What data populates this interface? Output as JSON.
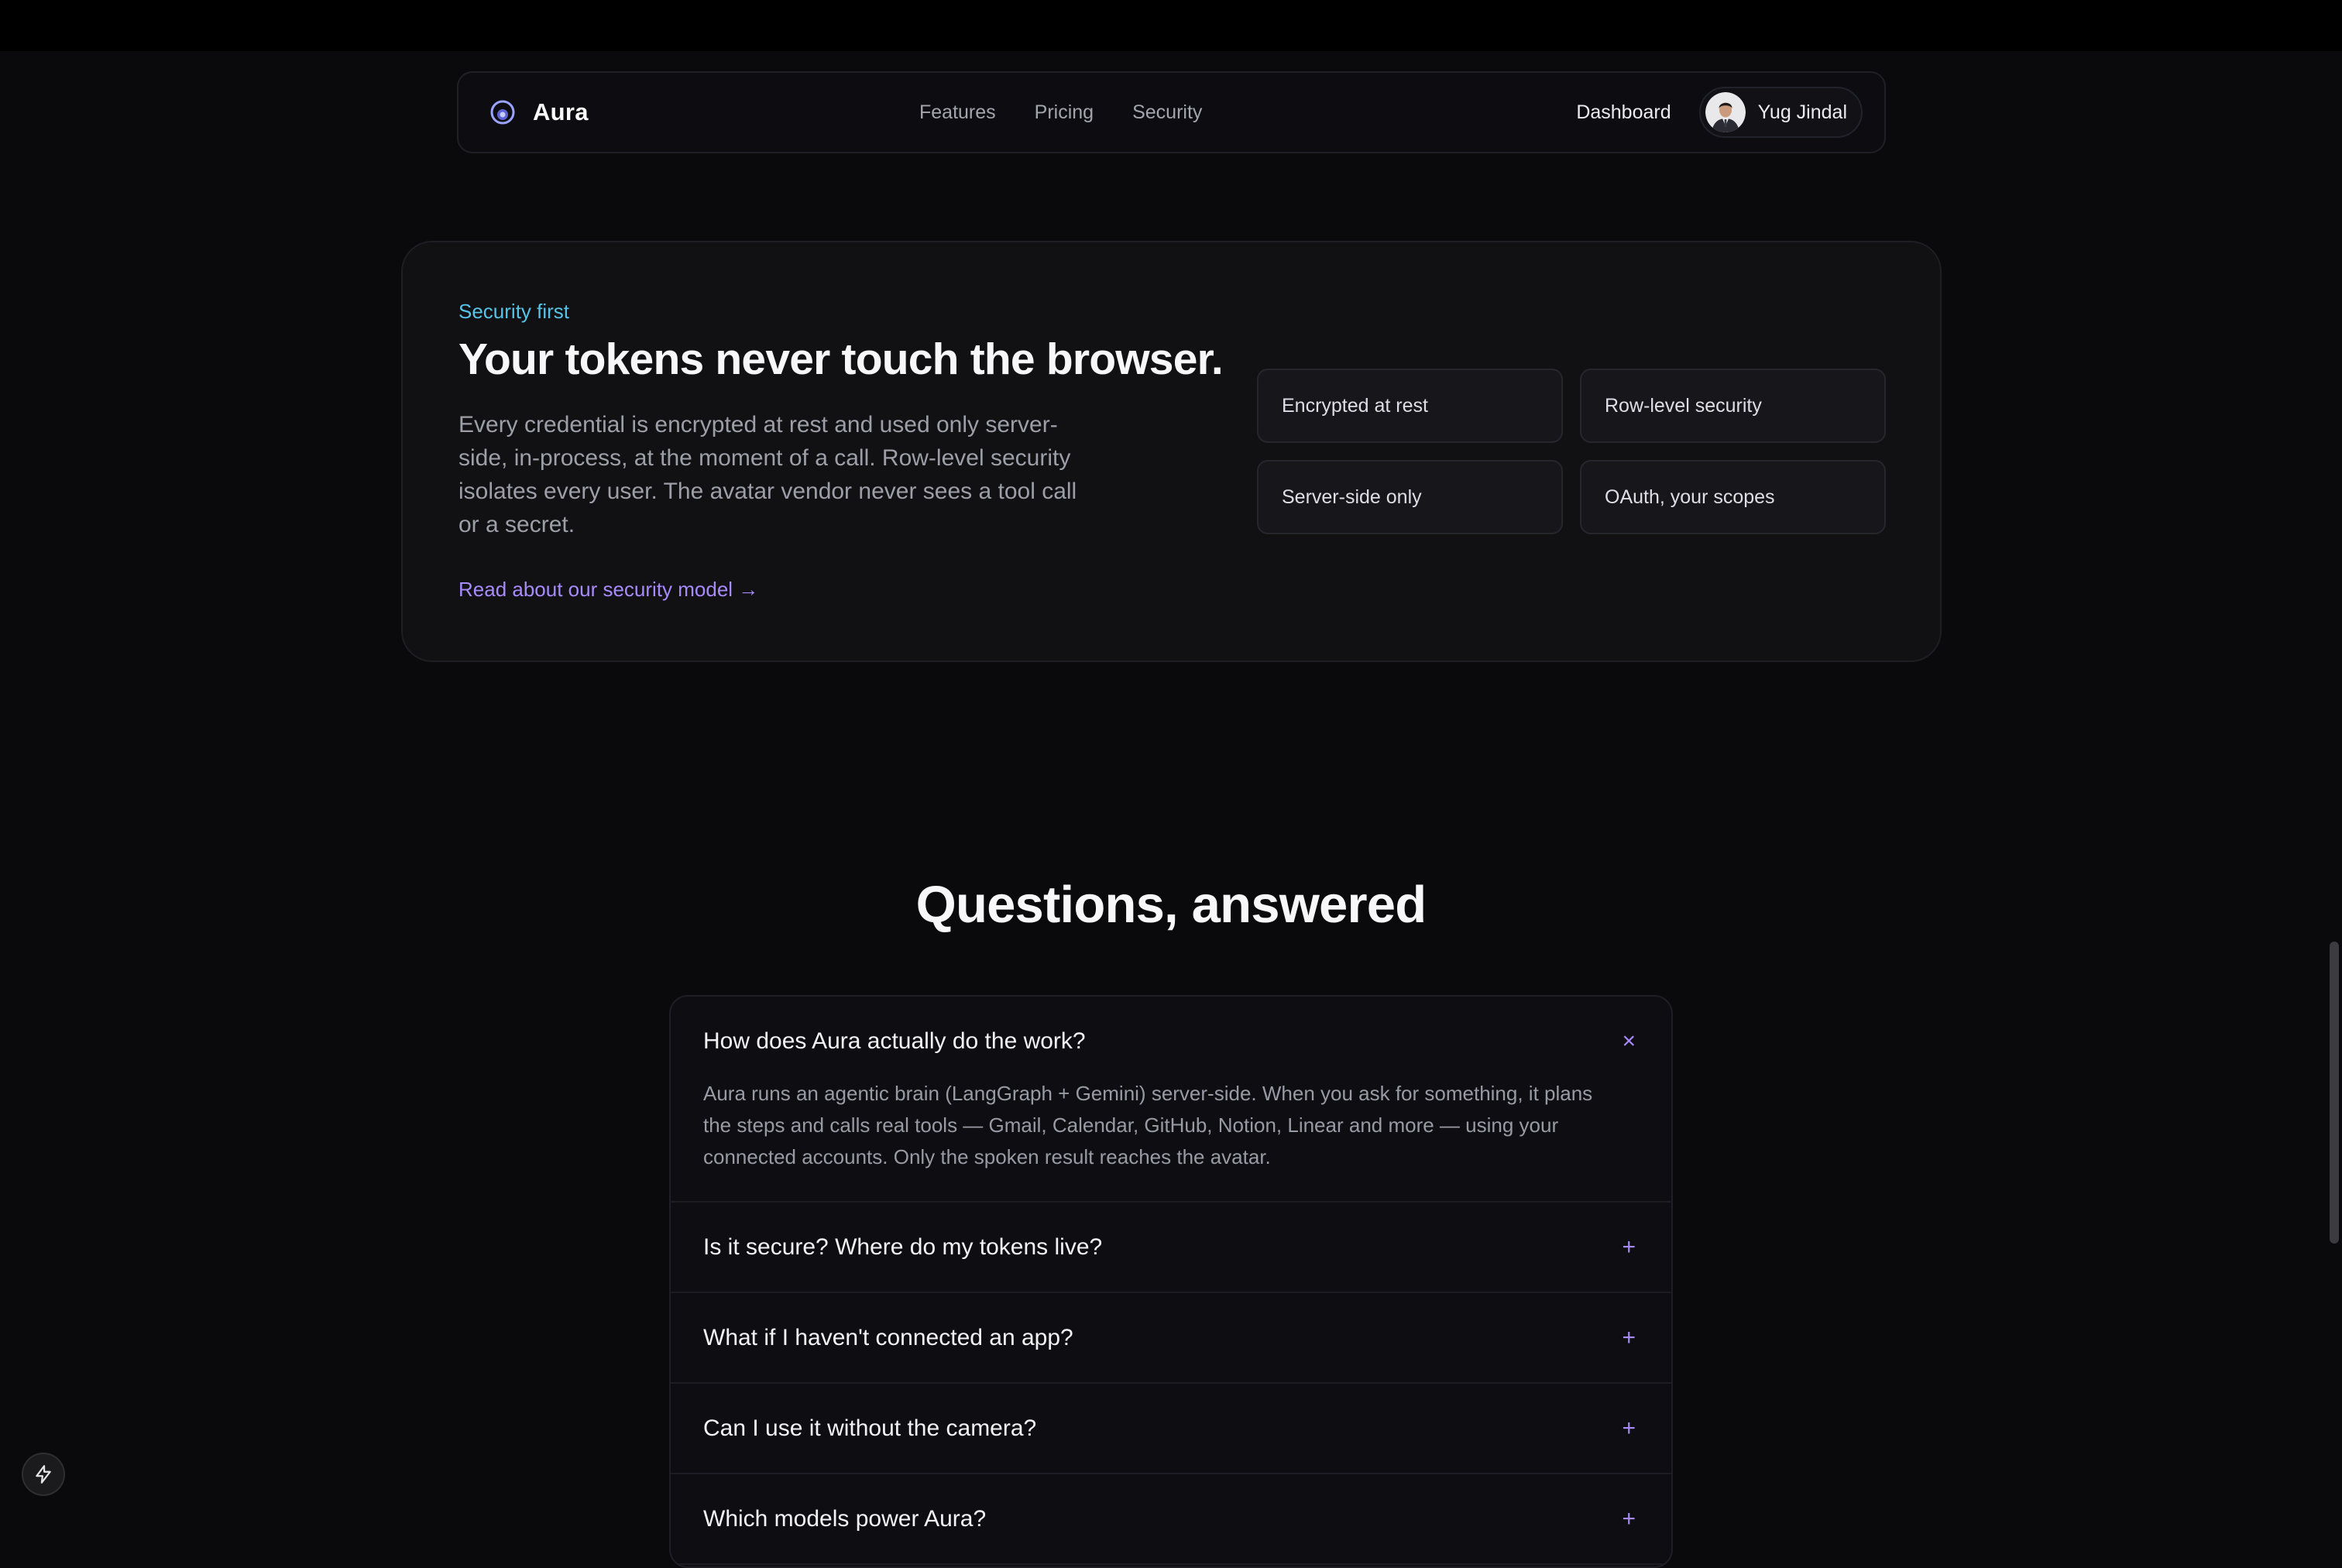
{
  "nav": {
    "brand": "Aura",
    "links": [
      "Features",
      "Pricing",
      "Security"
    ],
    "dashboard": "Dashboard",
    "user_name": "Yug Jindal"
  },
  "security": {
    "eyebrow": "Security first",
    "title": "Your tokens never touch the browser.",
    "body": "Every credential is encrypted at rest and used only server-side, in-process, at the moment of a call. Row-level security isolates every user. The avatar vendor never sees a tool call or a secret.",
    "link": "Read about our security model →",
    "features": [
      "Encrypted at rest",
      "Row-level security",
      "Server-side only",
      "OAuth, your scopes"
    ]
  },
  "faq": {
    "title": "Questions, answered",
    "items": [
      {
        "question": "How does Aura actually do the work?",
        "answer": "Aura runs an agentic brain (LangGraph + Gemini) server-side. When you ask for something, it plans the steps and calls real tools — Gmail, Calendar, GitHub, Notion, Linear and more — using your connected accounts. Only the spoken result reaches the avatar.",
        "toggle": "×"
      },
      {
        "question": "Is it secure? Where do my tokens live?",
        "toggle": "+"
      },
      {
        "question": "What if I haven't connected an app?",
        "toggle": "+"
      },
      {
        "question": "Can I use it without the camera?",
        "toggle": "+"
      },
      {
        "question": "Which models power Aura?",
        "toggle": "+"
      }
    ]
  },
  "colors": {
    "accent_cyan": "#58c3e6",
    "accent_purple": "#a78bfa",
    "background": "#0a0a0d"
  },
  "icons": {
    "brand": "aura-logo-icon",
    "floating": "lightning-bolt-icon"
  }
}
